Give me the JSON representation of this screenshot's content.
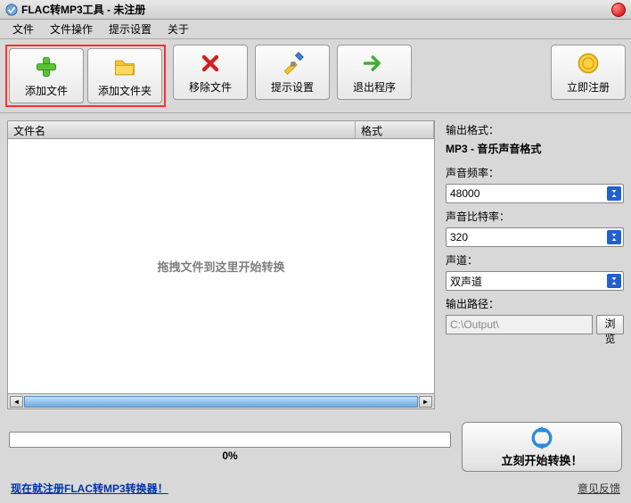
{
  "title": "FLAC转MP3工具 - 未注册",
  "menu": {
    "file": "文件",
    "fileop": "文件操作",
    "tipset": "提示设置",
    "about": "关于"
  },
  "toolbar": {
    "addfile": "添加文件",
    "addfolder": "添加文件夹",
    "remove": "移除文件",
    "tipset": "提示设置",
    "exit": "退出程序",
    "register": "立即注册"
  },
  "list": {
    "col_name": "文件名",
    "col_format": "格式",
    "placeholder": "拖拽文件到这里开始转换"
  },
  "right": {
    "outfmt_label": "输出格式：",
    "outfmt_value": "MP3 - 音乐声音格式",
    "freq_label": "声音频率：",
    "freq_value": "48000",
    "bitrate_label": "声音比特率：",
    "bitrate_value": "320",
    "channel_label": "声道：",
    "channel_value": "双声道",
    "outpath_label": "输出路径：",
    "outpath_value": "C:\\Output\\",
    "browse": "浏览"
  },
  "progress": {
    "text": "0%"
  },
  "start_btn": "立刻开始转换！",
  "footer": {
    "register_link": "现在就注册FLAC转MP3转换器！",
    "feedback": "意见反馈"
  }
}
